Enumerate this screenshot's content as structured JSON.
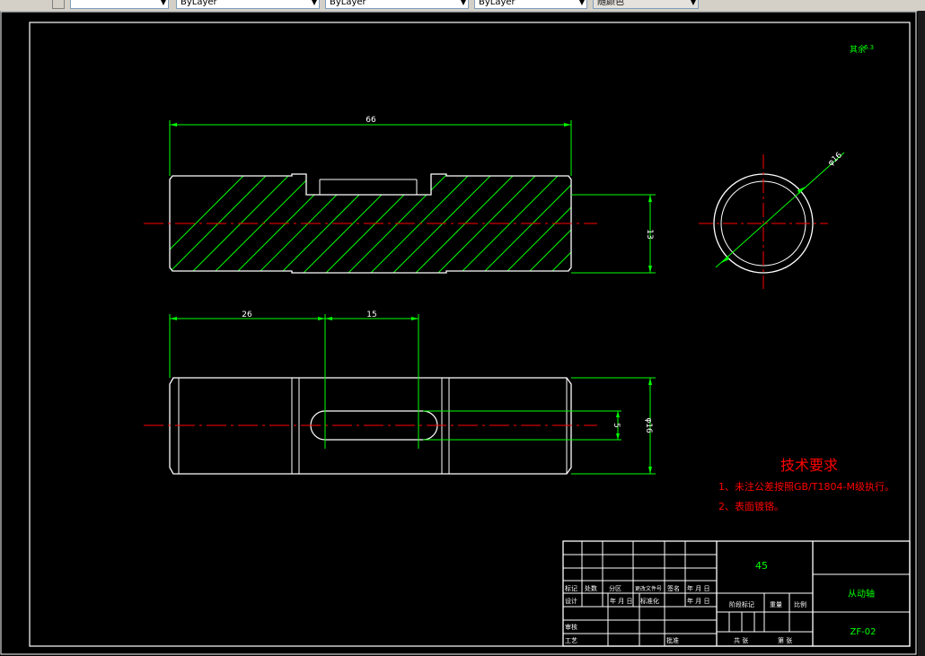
{
  "toolbar": {
    "layer_value": "",
    "linetype_value": "ByLayer",
    "lineweight_value": "ByLayer",
    "plotstyle_value": "ByLayer",
    "color_value": "随颜色"
  },
  "drawing": {
    "top_right_note": "其余",
    "top_right_roughness": "6.3",
    "dims": {
      "overall_length": "66",
      "flat_height": "13",
      "section_diameter": "φ16",
      "keyway_offset": "26",
      "keyway_length": "15",
      "keyway_width": "5",
      "shaft_diameter": "φ16"
    },
    "tech_req": {
      "title": "技术要求",
      "line1": "1、未注公差按照GB/T1804-M级执行。",
      "line2": "2、表面镀铬。"
    },
    "title_block": {
      "material": "45",
      "part_name": "从动轴",
      "drawing_no": "ZF-02",
      "hdr_mark": "标记",
      "hdr_count": "处数",
      "hdr_zone": "分区",
      "hdr_docno": "更改文件号",
      "hdr_sign": "签名",
      "hdr_date": "年 月 日",
      "design": "设计",
      "standardize": "标准化",
      "year_month": "年 月 日",
      "stage_mark": "阶段标记",
      "weight": "重量",
      "scale": "比例",
      "review": "审核",
      "process": "工艺",
      "approve": "批准",
      "sheets_total": "共  张",
      "sheet_no": "第  张"
    }
  }
}
